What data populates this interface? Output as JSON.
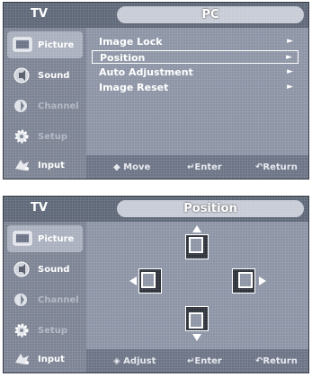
{
  "screen1": {
    "tv_label": "TV",
    "title": "PC",
    "sidebar": [
      {
        "label": "Picture",
        "icon": "picture-icon",
        "state": "active"
      },
      {
        "label": "Sound",
        "icon": "sound-icon",
        "state": "normal"
      },
      {
        "label": "Channel",
        "icon": "channel-icon",
        "state": "dim"
      },
      {
        "label": "Setup",
        "icon": "setup-icon",
        "state": "dim"
      },
      {
        "label": "Input",
        "icon": "input-icon",
        "state": "normal"
      }
    ],
    "menu": [
      {
        "label": "Image Lock",
        "arrow": "►"
      },
      {
        "label": "Position",
        "arrow": "►",
        "selected": true
      },
      {
        "label": "Auto Adjustment",
        "arrow": "►"
      },
      {
        "label": "Image Reset",
        "arrow": "►"
      }
    ],
    "hints": {
      "move": "◆ Move",
      "enter": "Enter",
      "return": "Return"
    }
  },
  "screen2": {
    "tv_label": "TV",
    "title": "Position",
    "sidebar": [
      {
        "label": "Picture",
        "icon": "picture-icon",
        "state": "active"
      },
      {
        "label": "Sound",
        "icon": "sound-icon",
        "state": "normal"
      },
      {
        "label": "Channel",
        "icon": "channel-icon",
        "state": "dim"
      },
      {
        "label": "Setup",
        "icon": "setup-icon",
        "state": "dim"
      },
      {
        "label": "Input",
        "icon": "input-icon",
        "state": "normal"
      }
    ],
    "hints": {
      "adjust": "Adjust",
      "enter": "Enter",
      "return": "Return"
    }
  }
}
